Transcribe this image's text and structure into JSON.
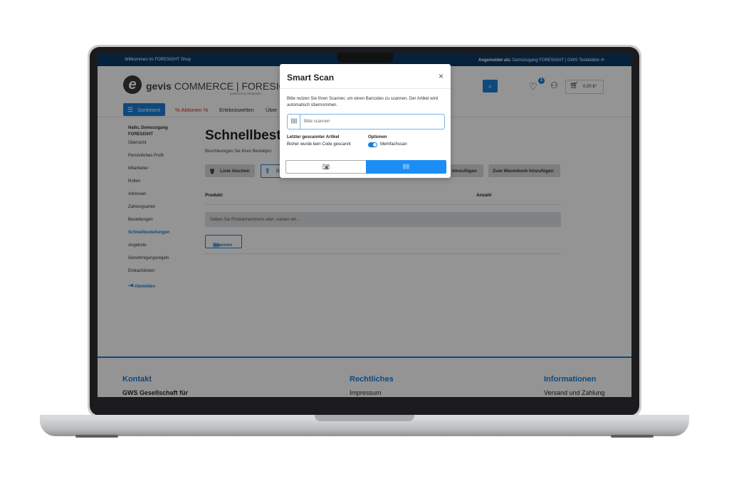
{
  "topbar": {
    "welcome": "Willkommen im FORESIGHT Shop",
    "logged_in_label": "Angemeldet als:",
    "logged_in_value": "Demozugang FORESIGHT | GWS Testdebitor"
  },
  "brand": {
    "logo_letter": "e",
    "name_bold": "gevis",
    "name_rest": " COMMERCE | FORESIGHT",
    "powered": "powered by shopware"
  },
  "header": {
    "wishlist_count": "1",
    "cart_total": "0,00 €*"
  },
  "nav": {
    "sortiment": "Sortiment",
    "aktionen": "% Aktionen %",
    "erlebniswelten": "Erlebniswelten",
    "ueber": "Über"
  },
  "sidebar": {
    "greeting": "Hallo, Demozugang FORESIGHT",
    "items": [
      {
        "label": "Übersicht"
      },
      {
        "label": "Persönliches Profil"
      },
      {
        "label": "Mitarbeiter"
      },
      {
        "label": "Rollen"
      },
      {
        "label": "Adressen"
      },
      {
        "label": "Zahlungsarten"
      },
      {
        "label": "Bestellungen"
      },
      {
        "label": "Schnellbestellungen"
      },
      {
        "label": "Angebote"
      },
      {
        "label": "Genehmigungsregeln"
      },
      {
        "label": "Einkaufslisten"
      }
    ],
    "logout": "Abmelden"
  },
  "main": {
    "title": "Schnellbeste",
    "subtitle": "Beschleunigen Sie Ihren Bestellpro",
    "btn_clear": "Liste löschen",
    "btn_d": "D",
    "btn_add_partial": "hinzufügen",
    "btn_add_cart": "Zum Warenkorb hinzufügen",
    "col_product": "Produkt",
    "col_qty": "Anzahl",
    "input_placeholder": "Geben Sie Produktnummern oder -namen ein ...",
    "scan_btn": "Scannen"
  },
  "footer": {
    "kontakt": "Kontakt",
    "kontakt_text": "GWS Gesellschaft für",
    "rechtliches": "Rechtliches",
    "rechtliches_text": "Impressum",
    "informationen": "Informationen",
    "informationen_text": "Versand und Zahlung"
  },
  "modal": {
    "title": "Smart Scan",
    "close": "×",
    "description": "Bitte nutzen Sie Ihren Scanner, um einen Barcodes zu scannen. Der Artikel wird automatisch übernommen.",
    "input_placeholder": "Bitte scannen",
    "last_label": "Letzter gescannter Artikel",
    "last_value": "Bisher wurde kein Code gescannt",
    "options_label": "Optionen",
    "multi_scan": "Mehrfachscan",
    "multi_scan_on": true
  }
}
